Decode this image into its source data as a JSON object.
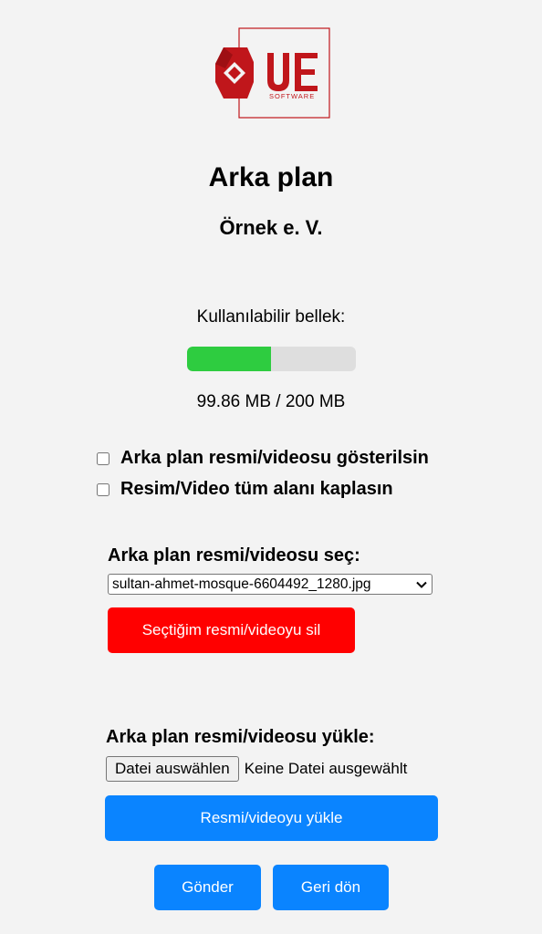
{
  "logo": {
    "text": "UE",
    "subtext": "SOFTWARE",
    "color": "#c0161b"
  },
  "header": {
    "title": "Arka plan",
    "organization": "Örnek e. V."
  },
  "memory": {
    "label": "Kullanılabilir bellek:",
    "used_mb": 99.86,
    "total_mb": 200,
    "fraction": 0.4993,
    "text": "99.86 MB / 200 MB",
    "fill_color": "#2ecc40",
    "track_color": "#dedede"
  },
  "options": {
    "show_background_label": "Arka plan resmi/videosu gösterilsin",
    "show_background_checked": false,
    "cover_area_label": "Resim/Video tüm alanı kaplasın",
    "cover_area_checked": false
  },
  "select_section": {
    "title": "Arka plan resmi/videosu seç:",
    "selected_value": "sultan-ahmet-mosque-6604492_1280.jpg",
    "delete_button": "Seçtiğim resmi/videoyu sil"
  },
  "upload_section": {
    "title": "Arka plan resmi/videosu yükle:",
    "file_button": "Datei auswählen",
    "file_status": "Keine Datei ausgewählt",
    "upload_button": "Resmi/videoyu yükle"
  },
  "actions": {
    "send_button": "Gönder",
    "back_button": "Geri dön"
  },
  "colors": {
    "background": "#f3f3f3",
    "danger": "#ff0000",
    "primary": "#0a84ff"
  }
}
